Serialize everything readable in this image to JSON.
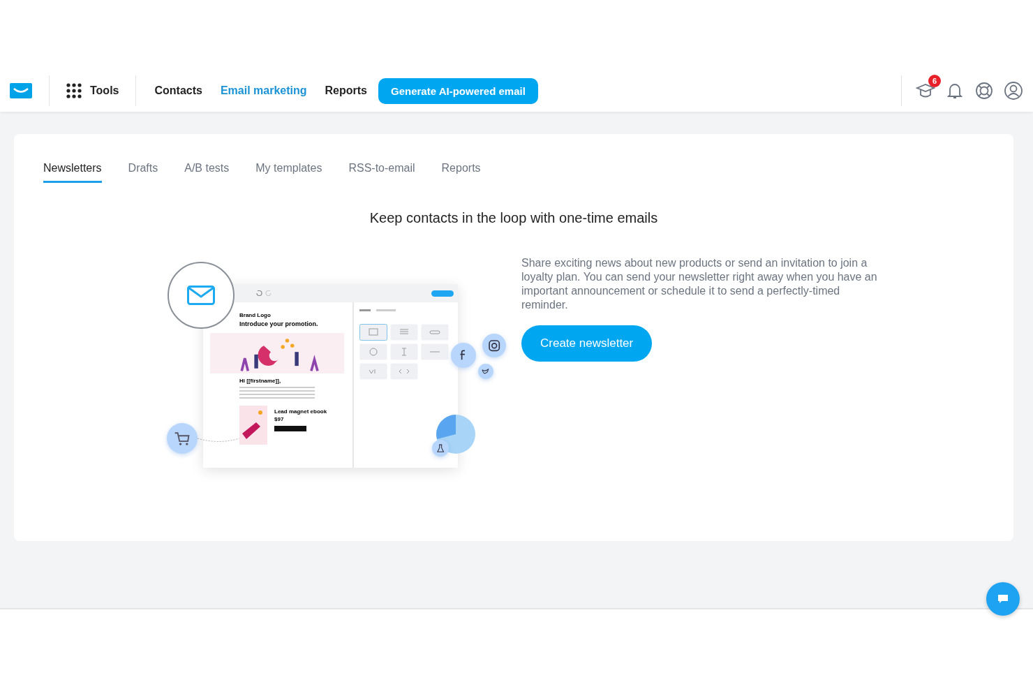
{
  "nav": {
    "tools": "Tools",
    "links": [
      {
        "label": "Contacts",
        "selected": false
      },
      {
        "label": "Email marketing",
        "selected": true
      },
      {
        "label": "Reports",
        "selected": false
      }
    ],
    "cta": "Generate AI-powered email",
    "notification_count": "6"
  },
  "tabs": [
    {
      "label": "Newsletters",
      "selected": true
    },
    {
      "label": "Drafts",
      "selected": false
    },
    {
      "label": "A/B tests",
      "selected": false
    },
    {
      "label": "My templates",
      "selected": false
    },
    {
      "label": "RSS-to-email",
      "selected": false
    },
    {
      "label": "Reports",
      "selected": false
    }
  ],
  "heading": "Keep contacts in the loop with one-time emails",
  "illustration": {
    "brand": "Brand Logo",
    "headline": "Introduce your promotion.",
    "greeting": "Hi [[firstname]],",
    "product": "Lead magnet ebook",
    "price": "$97"
  },
  "description": "Share exciting news about new products or send an invitation to join a loyalty plan. You can send your newsletter right away when you have an important announcement or schedule it to send a perfectly-timed reminder.",
  "button": "Create newsletter"
}
